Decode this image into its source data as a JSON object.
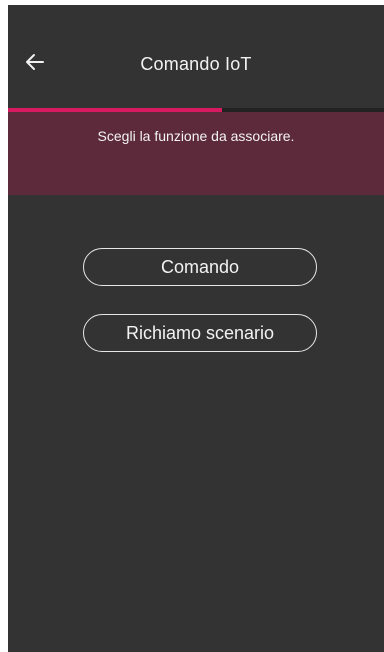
{
  "header": {
    "title": "Comando IoT",
    "back_icon": "arrow-left-icon"
  },
  "progress": {
    "value": 0.57,
    "color": "#d81b60"
  },
  "banner": {
    "text": "Scegli la funzione da associare.",
    "background": "#5d2a3c"
  },
  "options": [
    {
      "label": "Comando"
    },
    {
      "label": "Richiamo scenario"
    }
  ],
  "colors": {
    "background": "#333333",
    "accent": "#d81b60"
  }
}
